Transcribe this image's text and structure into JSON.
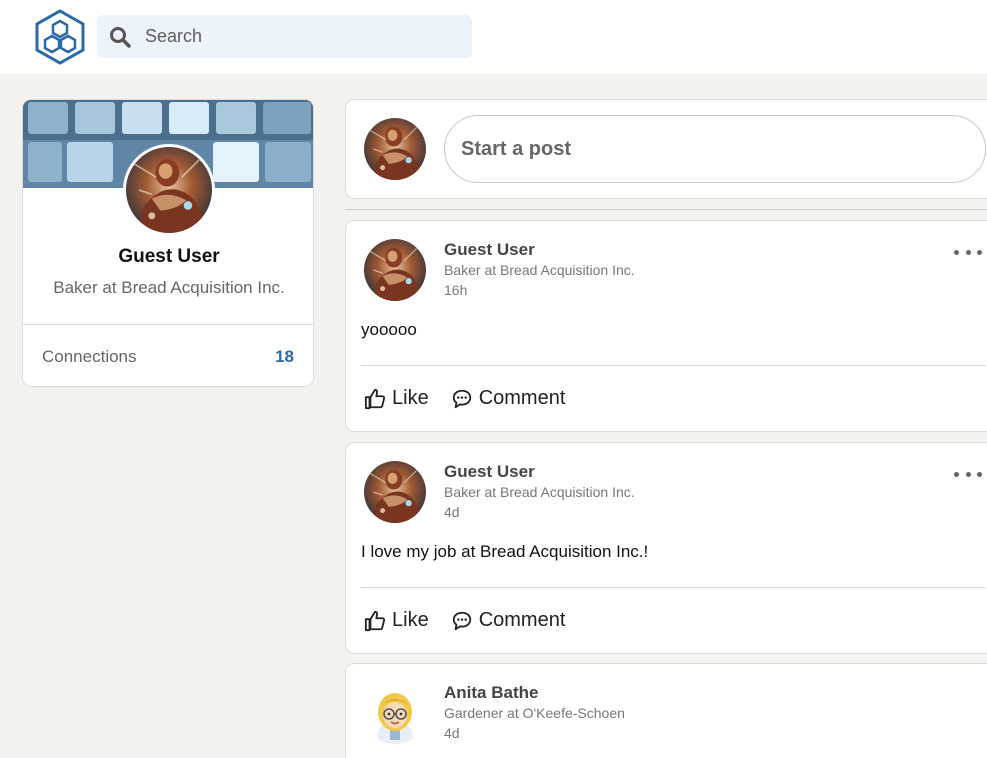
{
  "app": {
    "logo_icon": "hexagon-logo-icon"
  },
  "search": {
    "placeholder": "Search",
    "icon": "search-icon"
  },
  "profile": {
    "name": "Guest User",
    "title": "Baker at Bread Acquisition Inc.",
    "connections_label": "Connections",
    "connections_count": "18"
  },
  "composer": {
    "placeholder": "Start a post"
  },
  "posts": [
    {
      "author": "Guest User",
      "subtitle": "Baker at Bread Acquisition Inc.",
      "time": "16h",
      "content": "yooooo",
      "like_label": "Like",
      "comment_label": "Comment"
    },
    {
      "author": "Guest User",
      "subtitle": "Baker at Bread Acquisition Inc.",
      "time": "4d",
      "content": "I love my job at Bread Acquisition Inc.!",
      "like_label": "Like",
      "comment_label": "Comment"
    },
    {
      "author": "Anita Bathe",
      "subtitle": "Gardener at O'Keefe-Schoen",
      "time": "4d"
    }
  ],
  "colors": {
    "accent": "#2a6aa8",
    "background": "#f3f2ef",
    "search_bg": "#edf3fb"
  }
}
